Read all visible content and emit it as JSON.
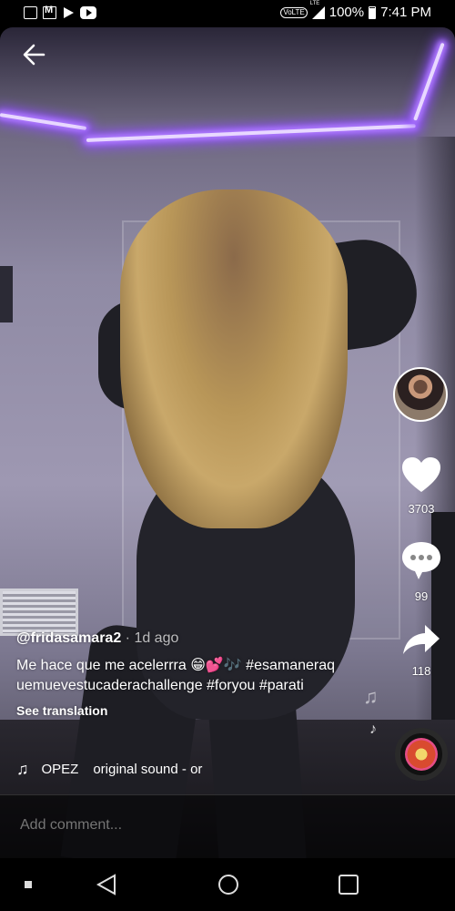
{
  "status_bar": {
    "battery": "100%",
    "time": "7:41 PM",
    "network": "LTE",
    "volte": "VoLTE"
  },
  "post": {
    "username": "@fridasamara2",
    "time_ago": " · 1d ago",
    "description": "Me hace que me acelerrra 😁💕🎶 #esamaneraquemuevestucaderachallenge #foryou #parati",
    "see_translation": "See translation",
    "sound_author": "OPEZ",
    "sound_title": "original sound - or"
  },
  "actions": {
    "likes": "3703",
    "comments": "99",
    "shares": "118"
  },
  "comment_input": {
    "placeholder": "Add comment..."
  },
  "colors": {
    "led": "#b07cff",
    "background": "#000000"
  }
}
